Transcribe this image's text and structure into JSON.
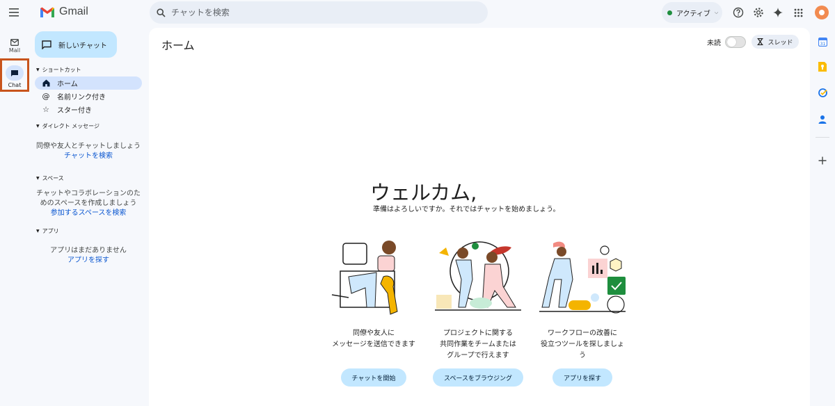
{
  "header": {
    "logo_text": "Gmail",
    "search_placeholder": "チャットを検索",
    "status_label": "アクティブ",
    "status_color": "#1e8e3e"
  },
  "rail": {
    "mail_label": "Mail",
    "chat_label": "Chat"
  },
  "sidebar": {
    "new_chat_label": "新しいチャット",
    "shortcuts_header": "ショートカット",
    "shortcuts": [
      {
        "label": "ホーム",
        "icon": "home-icon"
      },
      {
        "label": "名前リンク付き",
        "icon": "at-icon"
      },
      {
        "label": "スター付き",
        "icon": "star-icon"
      }
    ],
    "dm_header": "ダイレクト メッセージ",
    "dm_empty": "同僚や友人とチャットしましょう",
    "dm_link": "チャットを検索",
    "spaces_header": "スペース",
    "spaces_empty_1": "チャットやコラボレーションのた",
    "spaces_empty_2": "めのスペースを作成しましょう",
    "spaces_link": "参加するスペースを検索",
    "apps_header": "アプリ",
    "apps_empty": "アプリはまだありません",
    "apps_link": "アプリを探す"
  },
  "main": {
    "title": "ホーム",
    "unread_label": "未読",
    "thread_label": "スレッド",
    "welcome": "ウェルカム,",
    "welcome_sub": "準備はよろしいですか。それではチャットを始めましょう。",
    "cards": [
      {
        "line1": "同僚や友人に",
        "line2": "メッセージを送信できます",
        "line3": "",
        "button": "チャットを開始"
      },
      {
        "line1": "プロジェクトに関する",
        "line2": "共同作業をチームまたは",
        "line3": "グループで行えます",
        "button": "スペースをブラウジング"
      },
      {
        "line1": "ワークフローの改善に",
        "line2": "役立つツールを探しましょ",
        "line3": "う",
        "button": "アプリを探す"
      }
    ]
  },
  "colors": {
    "accent": "#c2e7ff",
    "active_nav": "#d3e3fd",
    "highlight_border": "#c8541c",
    "link": "#0b57d0"
  }
}
